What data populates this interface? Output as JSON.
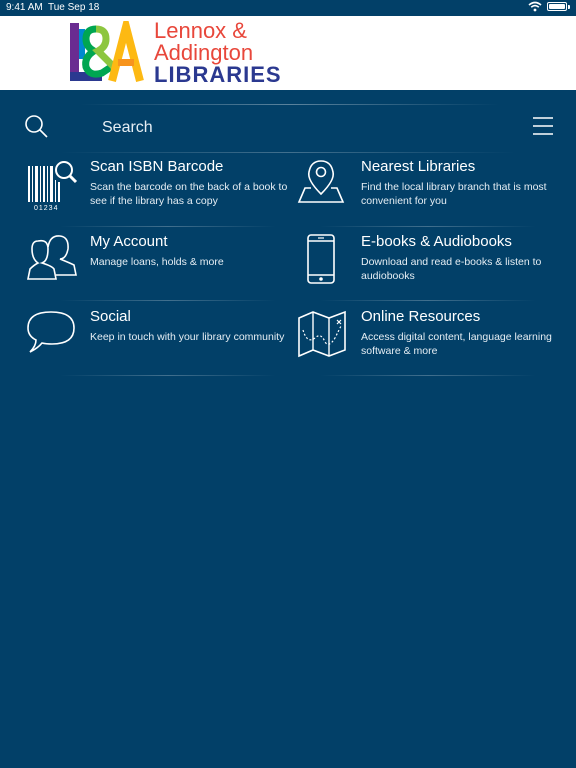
{
  "status_bar": {
    "time": "9:41 AM",
    "date": "Tue Sep 18"
  },
  "header": {
    "logo_mark": "L&A",
    "logo_line1": "Lennox &",
    "logo_line2": "Addington",
    "logo_line3": "LIBRARIES"
  },
  "search": {
    "placeholder": "Search"
  },
  "tiles": [
    {
      "title": "Scan ISBN Barcode",
      "description": "Scan the barcode on the back of a book to see if the library has a copy",
      "icon": "barcode-scan-icon",
      "barcode_number": "01234"
    },
    {
      "title": "Nearest Libraries",
      "description": "Find the local library branch that is most convenient for you",
      "icon": "map-pin-icon"
    },
    {
      "title": "My Account",
      "description": "Manage loans, holds & more",
      "icon": "users-icon"
    },
    {
      "title": "E-books & Audiobooks",
      "description": "Download and read e-books & listen to audiobooks",
      "icon": "smartphone-icon"
    },
    {
      "title": "Social",
      "description": "Keep in touch with your library community",
      "icon": "chat-bubble-icon"
    },
    {
      "title": "Online Resources",
      "description": "Access digital content, language learning software & more",
      "icon": "map-icon"
    }
  ],
  "colors": {
    "background": "#024068",
    "logo_red": "#e8473b",
    "logo_blue": "#2b3990"
  }
}
